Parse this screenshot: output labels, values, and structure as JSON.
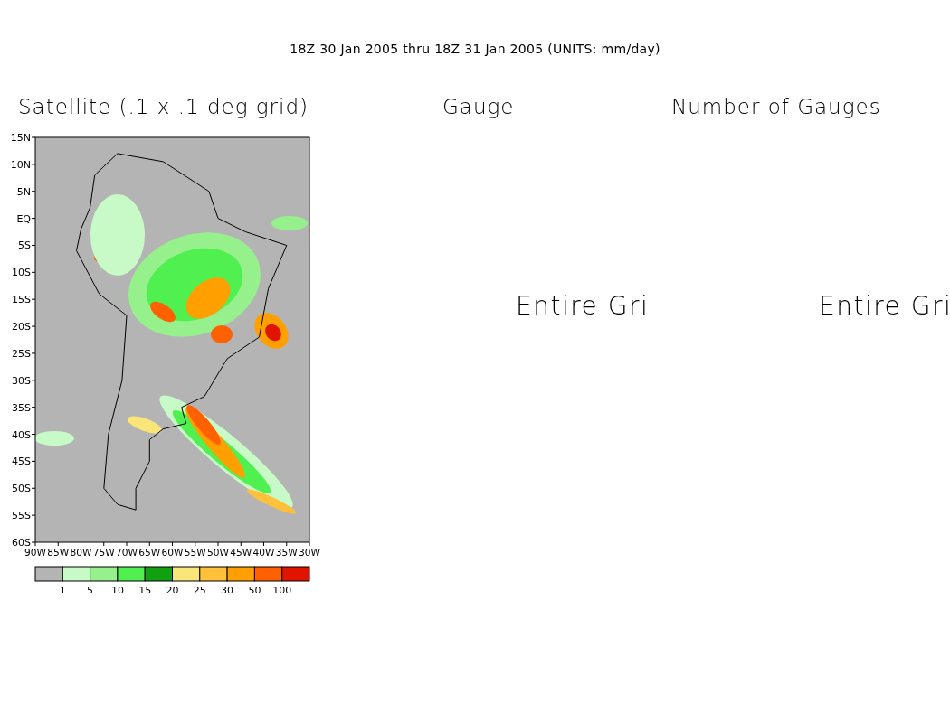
{
  "title": "18Z 30 Jan 2005 thru 18Z 31 Jan 2005 (UNITS: mm/day)",
  "panels": [
    {
      "kind": "map",
      "title": "Satellite (.1 x .1 deg grid)",
      "y_labels": [
        "15N",
        "10N",
        "5N",
        "EQ",
        "5S",
        "10S",
        "15S",
        "20S",
        "25S",
        "30S",
        "35S",
        "40S",
        "45S",
        "50S",
        "55S",
        "60S"
      ],
      "x_labels": [
        "90W",
        "85W",
        "80W",
        "75W",
        "70W",
        "65W",
        "60W",
        "55W",
        "50W",
        "45W",
        "40W",
        "35W",
        "30W"
      ],
      "colorbar": [
        {
          "color": "#b4b4b4"
        },
        {
          "color": "#c8fac8",
          "label": "1"
        },
        {
          "color": "#96f08c",
          "label": "5"
        },
        {
          "color": "#50f050",
          "label": "10"
        },
        {
          "color": "#10a010",
          "label": "15"
        },
        {
          "color": "#fae678",
          "label": "20"
        },
        {
          "color": "#ffc03c",
          "label": "25"
        },
        {
          "color": "#ffa000",
          "label": "30"
        },
        {
          "color": "#ff6000",
          "label": "50"
        },
        {
          "color": "#e11400",
          "label": "100"
        }
      ]
    },
    {
      "kind": "message",
      "title": "Gauge",
      "message": "Entire Gri"
    },
    {
      "kind": "message",
      "title": "Number of Gauges",
      "message": "Entire Gri"
    }
  ]
}
